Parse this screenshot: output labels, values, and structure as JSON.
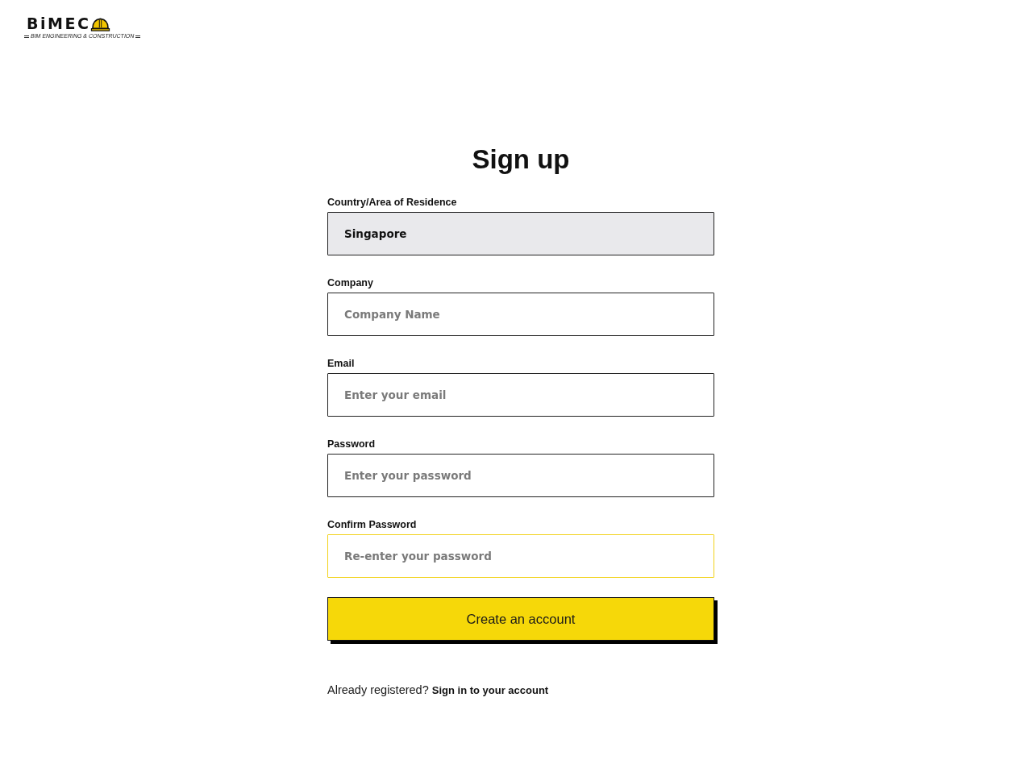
{
  "logo": {
    "wordmark": "BiMEC",
    "tagline": "BIM ENGINEERING & CONSTRUCTION"
  },
  "title": "Sign up",
  "fields": [
    {
      "label": "Country/Area of Residence",
      "value": "Singapore",
      "disabled": true,
      "focused": false
    },
    {
      "label": "Company",
      "placeholder": "Company Name",
      "disabled": false,
      "focused": false
    },
    {
      "label": "Email",
      "placeholder": "Enter your email",
      "disabled": false,
      "focused": false
    },
    {
      "label": "Password",
      "placeholder": "Enter your password",
      "disabled": false,
      "focused": false
    },
    {
      "label": "Confirm Password",
      "placeholder": "Re-enter your password",
      "disabled": false,
      "focused": true
    }
  ],
  "submit_button": "Create an account",
  "footer": {
    "text": "Already registered?",
    "link": "Sign in to your account"
  }
}
